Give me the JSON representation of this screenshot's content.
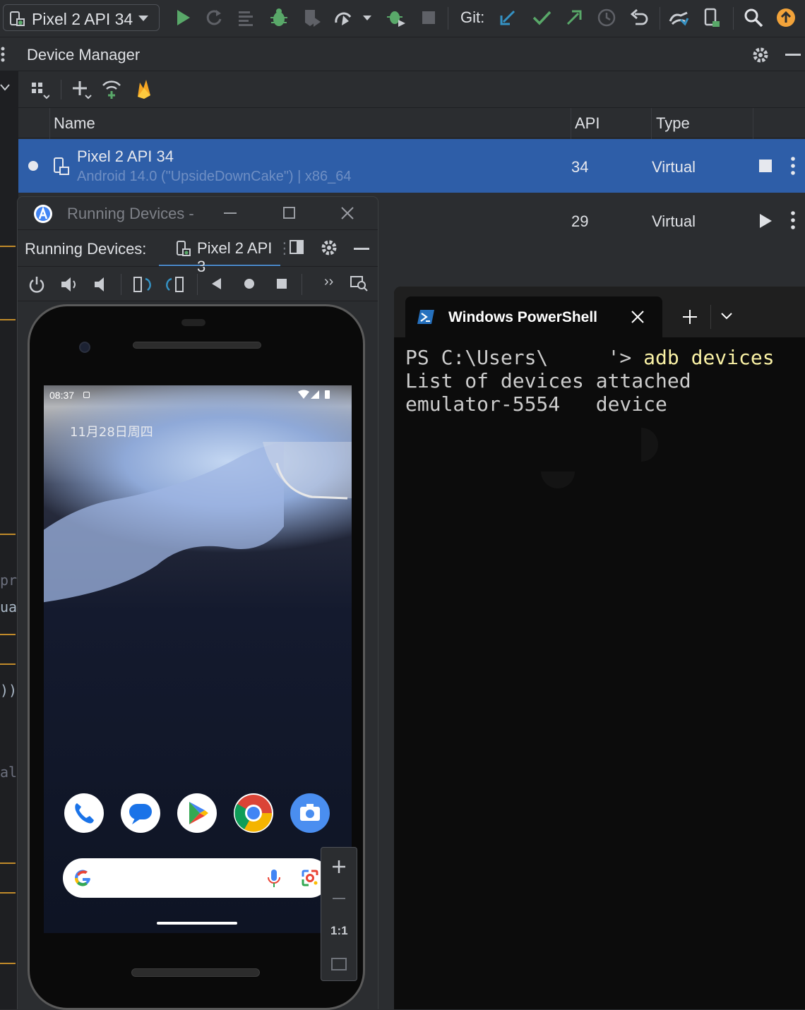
{
  "toolbar": {
    "run_config": "Pixel 2 API 34",
    "git_label": "Git:",
    "icons": [
      "run-icon",
      "rerun-icon",
      "coverage-icon",
      "debug-icon",
      "profile-icon",
      "attach-icon",
      "apply-changes-icon",
      "stop-icon",
      "git-update-icon",
      "git-commit-icon",
      "git-push-icon",
      "history-icon",
      "revert-icon",
      "device-mirroring-icon",
      "device-manager-icon",
      "search-icon",
      "update-icon"
    ]
  },
  "device_manager": {
    "title": "Device Manager",
    "columns": {
      "name": "Name",
      "api": "API",
      "type": "Type"
    },
    "rows": [
      {
        "name": "Pixel 2 API 34",
        "details": "Android 14.0 (\"UpsideDownCake\") | x86_64",
        "api": "34",
        "type": "Virtual",
        "state": "running"
      },
      {
        "name": "",
        "details": "",
        "api": "29",
        "type": "Virtual",
        "state": "stopped"
      }
    ]
  },
  "running_devices": {
    "window_title": "Running Devices -",
    "label": "Running Devices:",
    "tab_label": "Pixel 2 API 3",
    "zoom_actual": "1:1"
  },
  "phone": {
    "time": "08:37",
    "date": "11月28日周四",
    "dock_apps": [
      "phone-app-icon",
      "messages-app-icon",
      "play-store-icon",
      "chrome-icon",
      "camera-app-icon"
    ]
  },
  "terminal": {
    "tab_title": "Windows PowerShell",
    "prompt": "PS C:\\Users\\     '> ",
    "command": "adb devices",
    "output_lines": [
      "List of devices attached",
      "emulator-5554   device"
    ]
  },
  "left_code": [
    "pr",
    "ua",
    "))",
    "al"
  ],
  "colors": {
    "selection": "#2e5ea8",
    "run_green": "#59a869",
    "accent_orange": "#f2a33a"
  }
}
